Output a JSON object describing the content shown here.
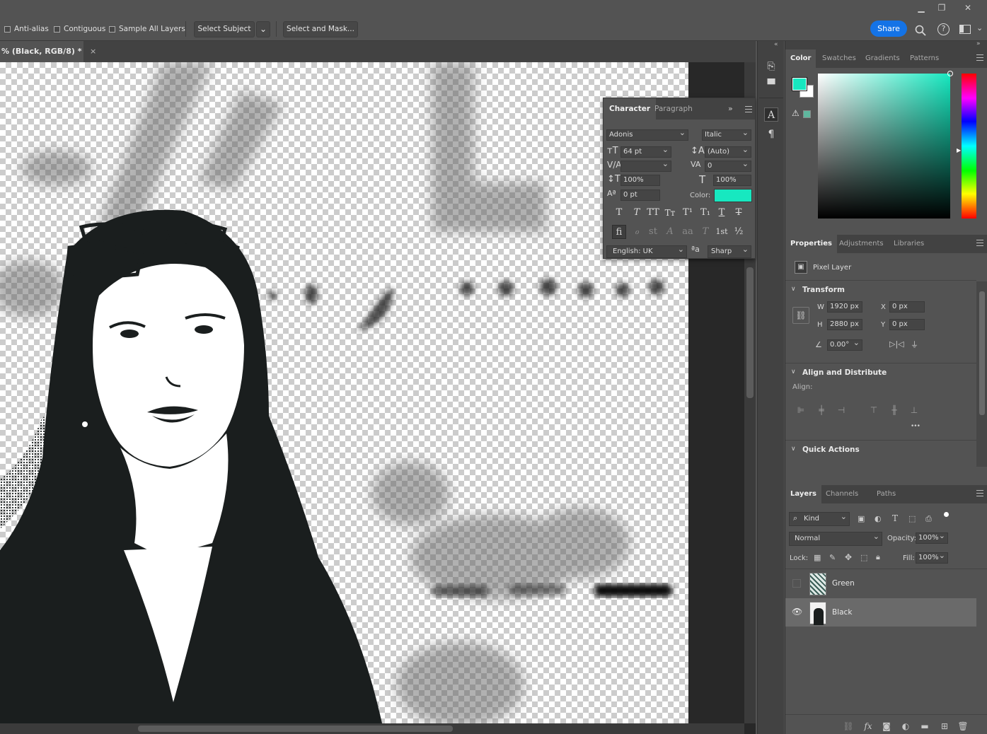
{
  "window": {
    "minimize_glyph": "▁",
    "restore_glyph": "❐",
    "close_glyph": "✕"
  },
  "options": {
    "anti_alias": "Anti-alias",
    "contiguous": "Contiguous",
    "sample_all_layers": "Sample All Layers",
    "select_subject": "Select Subject",
    "select_and_mask": "Select and Mask...",
    "share": "Share"
  },
  "document": {
    "tab_title": "% (Black, RGB/8) *",
    "close_glyph": "×"
  },
  "character_panel": {
    "tabs": [
      "Character",
      "Paragraph"
    ],
    "font_family": "Adonis",
    "font_style": "Italic",
    "font_size": "64 pt",
    "leading": "(Auto)",
    "kerning": "",
    "tracking": "0",
    "vertical_scale": "100%",
    "horizontal_scale": "100%",
    "baseline_shift": "0 pt",
    "color_label": "Color:",
    "color_value": "#17e8c0",
    "language": "English: UK",
    "antialias": "Sharp",
    "antialias_icon": "ªa",
    "style_buttons": [
      "T",
      "T",
      "TT",
      "Tт",
      "T¹",
      "T₁",
      "T",
      "T"
    ],
    "opentype_buttons": [
      "fi",
      "ℴ",
      "st",
      "A",
      "aa",
      "T",
      "1st",
      "½"
    ]
  },
  "color_panel": {
    "tabs": [
      "Color",
      "Swatches",
      "Gradients",
      "Patterns"
    ],
    "foreground": "#17e8c0",
    "background": "#ffffff",
    "hue": "#17e8c0"
  },
  "properties_panel": {
    "tabs": [
      "Properties",
      "Adjustments",
      "Libraries"
    ],
    "layer_type": "Pixel Layer",
    "transform_header": "Transform",
    "w_label": "W",
    "w_value": "1920 px",
    "h_label": "H",
    "h_value": "2880 px",
    "x_label": "X",
    "x_value": "0 px",
    "y_label": "Y",
    "y_value": "0 px",
    "angle_value": "0.00°",
    "align_header": "Align and Distribute",
    "align_label": "Align:",
    "more_glyph": "•••",
    "quick_actions_header": "Quick Actions"
  },
  "layers_panel": {
    "tabs": [
      "Layers",
      "Channels",
      "Paths"
    ],
    "filter_kind": "Kind",
    "blend_mode": "Normal",
    "opacity_label": "Opacity:",
    "opacity_value": "100%",
    "lock_label": "Lock:",
    "fill_label": "Fill:",
    "fill_value": "100%",
    "layers": [
      {
        "name": "Green",
        "visible": false,
        "selected": false
      },
      {
        "name": "Black",
        "visible": true,
        "selected": true
      }
    ],
    "bottom_icons": [
      "link-icon",
      "fx-icon",
      "mask-icon",
      "adjustment-icon",
      "folder-icon",
      "new-layer-icon",
      "trash-icon"
    ]
  },
  "colors": {
    "accent": "#1473e6",
    "selected_layer": "#6a6a6a",
    "ink": "#1a1e1e"
  }
}
